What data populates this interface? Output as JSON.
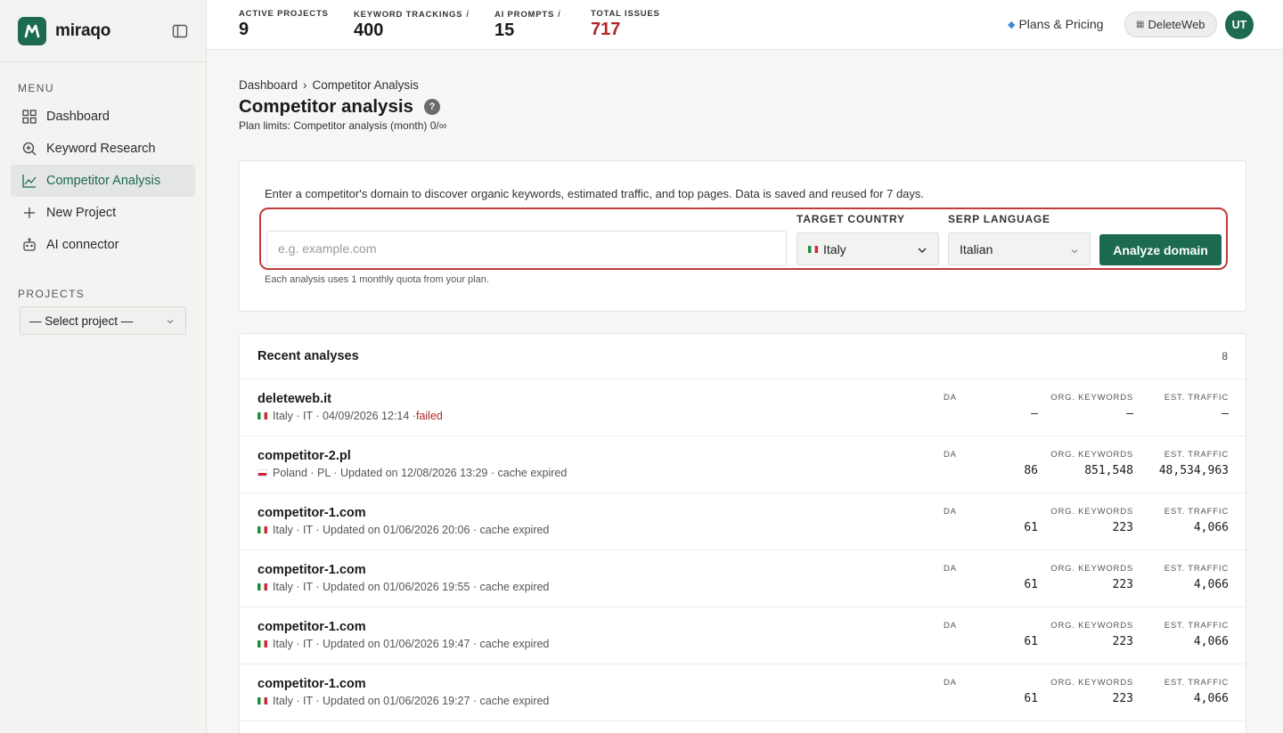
{
  "brand": {
    "name": "miraqo"
  },
  "sidebar": {
    "menu_label": "MENU",
    "items": [
      {
        "label": "Dashboard",
        "icon": "grid-icon"
      },
      {
        "label": "Keyword Research",
        "icon": "search-plus-icon"
      },
      {
        "label": "Competitor Analysis",
        "icon": "chart-line-icon",
        "active": true
      },
      {
        "label": "New Project",
        "icon": "plus-icon"
      },
      {
        "label": "AI connector",
        "icon": "robot-icon"
      }
    ],
    "projects_label": "PROJECTS",
    "project_select": "— Select project —"
  },
  "topbar": {
    "stats": [
      {
        "label": "ACTIVE PROJECTS",
        "value": "9"
      },
      {
        "label": "KEYWORD TRACKINGS",
        "value": "400",
        "info": "i"
      },
      {
        "label": "AI PROMPTS",
        "value": "15",
        "info": "i"
      },
      {
        "label": "TOTAL ISSUES",
        "value": "717"
      }
    ],
    "plans_label": "Plans & Pricing",
    "workspace_label": "DeleteWeb",
    "avatar_initials": "UT"
  },
  "page": {
    "breadcrumb": [
      "Dashboard",
      "Competitor Analysis"
    ],
    "breadcrumb_sep": "›",
    "title": "Competitor analysis",
    "help": "?",
    "plan_limits": "Plan limits: Competitor analysis (month) 0/∞"
  },
  "analyze": {
    "description": "Enter a competitor's domain to discover organic keywords, estimated traffic, and top pages. Data is saved and reused for 7 days.",
    "domain_placeholder": "e.g. example.com",
    "country_label": "TARGET COUNTRY",
    "country_value": "Italy",
    "language_label": "SERP LANGUAGE",
    "language_value": "Italian",
    "button_label": "Analyze domain",
    "quota_note": "Each analysis uses 1 monthly quota from your plan."
  },
  "recent": {
    "title": "Recent analyses",
    "count": "8",
    "col_da": "DA",
    "col_keywords": "ORG. KEYWORDS",
    "col_traffic": "EST. TRAFFIC",
    "rows": [
      {
        "domain": "deleteweb.it",
        "flag": "it",
        "meta": "Italy · IT · 04/09/2026 12:14 · ",
        "status": "failed",
        "da": "–",
        "keywords": "–",
        "traffic": "–"
      },
      {
        "domain": "competitor-2.pl",
        "flag": "pl",
        "meta": "Poland · PL · Updated on 12/08/2026 13:29 · cache expired",
        "da": "86",
        "keywords": "851,548",
        "traffic": "48,534,963"
      },
      {
        "domain": "competitor-1.com",
        "flag": "it",
        "meta": "Italy · IT · Updated on 01/06/2026 20:06 · cache expired",
        "da": "61",
        "keywords": "223",
        "traffic": "4,066"
      },
      {
        "domain": "competitor-1.com",
        "flag": "it",
        "meta": "Italy · IT · Updated on 01/06/2026 19:55 · cache expired",
        "da": "61",
        "keywords": "223",
        "traffic": "4,066"
      },
      {
        "domain": "competitor-1.com",
        "flag": "it",
        "meta": "Italy · IT · Updated on 01/06/2026 19:47 · cache expired",
        "da": "61",
        "keywords": "223",
        "traffic": "4,066"
      },
      {
        "domain": "competitor-1.com",
        "flag": "it",
        "meta": "Italy · IT · Updated on 01/06/2026 19:27 · cache expired",
        "da": "61",
        "keywords": "223",
        "traffic": "4,066"
      }
    ]
  },
  "colors": {
    "accent": "#1d6b4f",
    "danger": "#b3262a",
    "outline": "#c23a3f"
  }
}
